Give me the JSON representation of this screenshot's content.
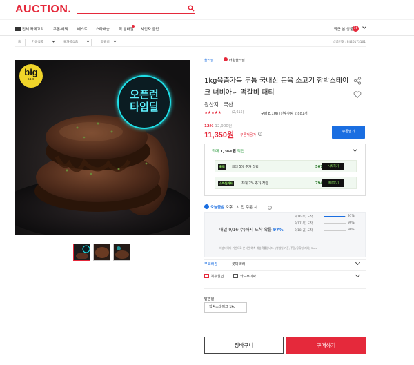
{
  "header": {
    "logo": "AUCTION."
  },
  "nav": {
    "items": [
      "전체 카테고리",
      "쿠폰·혜택",
      "베스트",
      "스타배송",
      "직 엠바일",
      "사업자 클럽"
    ],
    "recent_label": "최근 본 상품",
    "recent_count": "16"
  },
  "breadcrumb": {
    "items": [
      "홈",
      "가공식품",
      "육가공식품",
      "떡갈비"
    ],
    "product_code": "상품번호 : F426173161"
  },
  "product": {
    "brand": "올리닭",
    "store": "더원올리닭",
    "title": "1kg육즙가득 두툼 국내산 돈육 소고기 함박스테이크 너비아니 떡갈비 패티",
    "origin": "원산지 : 국산",
    "stars": "★★★★★",
    "rating_value": 4.5,
    "review_count": "(2,615)",
    "purchase_label": "구매 8,108",
    "purchase_extra": " (산후수량 2,881개)",
    "discount": "12%",
    "old_price": "12,900원",
    "price": "11,350원",
    "price_label": "쿠폰적용가",
    "coupon_button": "쿠폰받기"
  },
  "image_overlay": {
    "badge_big": "big",
    "badge_sale": "sale",
    "promo_line1": "오픈런",
    "promo_line2": "타임딜"
  },
  "points": {
    "head_prefix": "최대 ",
    "head_value": "1,361원",
    "head_suffix": " 적립",
    "rows": [
      {
        "tag": "클럽",
        "text": "최대 5% 추가 적립",
        "value": "567원",
        "button": "시작하기"
      },
      {
        "tag": "스마일카드",
        "text": "최대 7% 추가 적립",
        "value": "794원",
        "button": "혜택받기"
      }
    ]
  },
  "shipping": {
    "tag": "오늘출발",
    "line": " 오후 1시 전 주문 시",
    "arrive_prefix": "내일 9/16(수)까지 도착 확률 ",
    "arrive_pct": "97%",
    "rows": [
      {
        "label": "9/16(수) 도착",
        "pct": "97%",
        "fill": 0.97
      },
      {
        "label": "9/17(목) 도착",
        "pct": "99%",
        "fill": 0.0
      },
      {
        "label": "9/18(금) 도착",
        "pct": "99%",
        "fill": 0.0
      }
    ],
    "note": "배송데이터 기반으로 분석한 예측 배송확률입니다. (영업일 기준, 주말/공휴일 제외) 3kea",
    "fee_label": "무료배송",
    "carrier": "롯데택배"
  },
  "coupons": {
    "multi": "복수할인",
    "card": "카드무이자"
  },
  "option": {
    "label": "발송일",
    "value": "함박스테이크 1kg"
  },
  "actions": {
    "cart": "장바구니",
    "buy": "구매하기"
  },
  "colors": {
    "brand_red": "#e5293b",
    "link_blue": "#1a6ee1",
    "point_green": "#2c9a3f"
  }
}
